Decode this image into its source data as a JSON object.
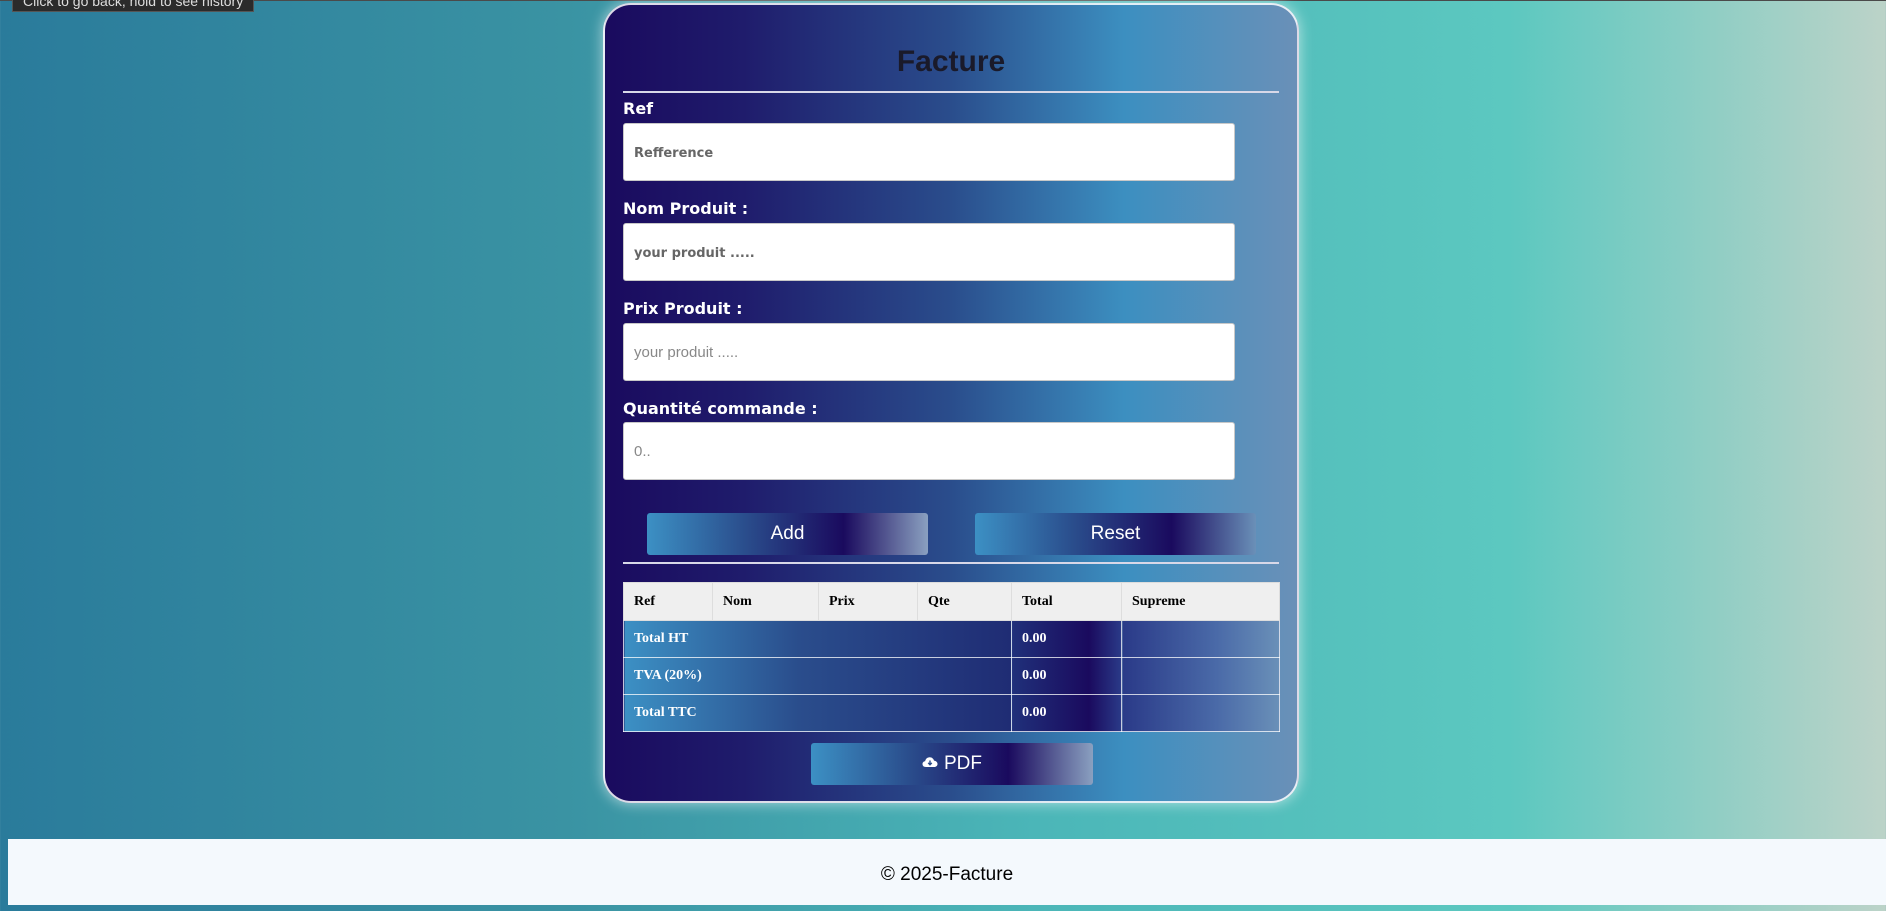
{
  "tooltip": "Click to go back, hold to see history",
  "form": {
    "title": "Facture",
    "ref_label": "Ref",
    "ref_placeholder": "Refference",
    "nom_label": "Nom Produit :",
    "nom_placeholder": "your produit .....",
    "prix_label": "Prix Produit :",
    "prix_placeholder": "your produit .....",
    "qte_label": "Quantité commande :",
    "qte_placeholder": "0..",
    "add_label": "Add",
    "reset_label": "Reset",
    "pdf_label": "PDF"
  },
  "table": {
    "headers": [
      "Ref",
      "Nom",
      "Prix",
      "Qte",
      "Total",
      "Supreme"
    ],
    "summary": [
      {
        "label": "Total HT",
        "value": "0.00"
      },
      {
        "label": "TVA (20%)",
        "value": "0.00"
      },
      {
        "label": "Total TTC",
        "value": "0.00"
      }
    ]
  },
  "footer": "© 2025-Facture",
  "icons": {
    "pdf_button_icon": "cloud-download-icon"
  },
  "colors": {
    "accent_dark": "#1a0a5e",
    "accent_light": "#3c90c4",
    "footer_bg": "#f4f9fd"
  }
}
